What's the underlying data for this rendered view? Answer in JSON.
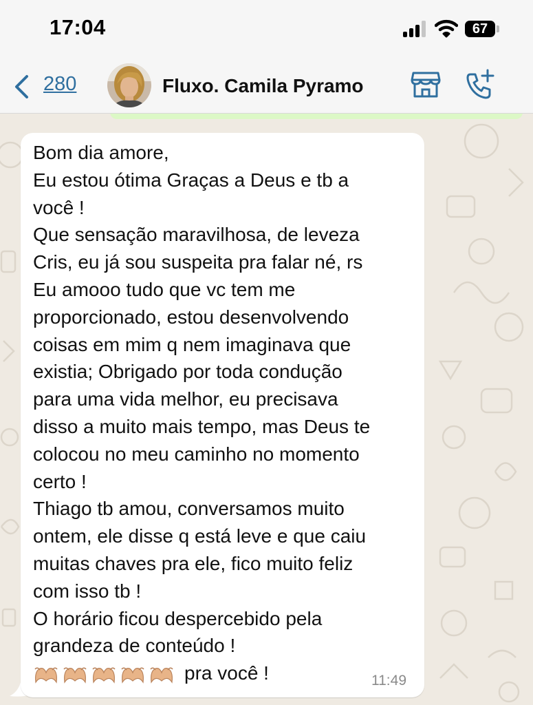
{
  "status_bar": {
    "time": "17:04",
    "battery": "67"
  },
  "header": {
    "back_count": "280",
    "contact_name": "Fluxo. Camila Pyramo",
    "icons": [
      "back-chevron-icon",
      "avatar",
      "store-icon",
      "add-call-icon"
    ]
  },
  "message": {
    "lines": [
      "Bom dia amore,",
      "Eu estou ótima Graças a Deus e tb a",
      "você !",
      "Que sensação maravilhosa, de leveza",
      "Cris, eu já sou suspeita pra falar né, rs",
      "Eu amooo tudo que vc tem me",
      "proporcionado, estou desenvolvendo",
      "coisas em mim q nem imaginava que",
      "existia; Obrigado por toda condução",
      "para uma vida melhor, eu precisava",
      "disso a muito mais tempo, mas Deus te",
      "colocou no meu caminho no momento",
      "certo !",
      "Thiago tb amou, conversamos muito",
      "ontem, ele disse q está leve e que caiu",
      "muitas chaves pra ele, fico muito feliz",
      "com isso tb !",
      "O horário ficou despercebido pela",
      "grandeza de conteúdo !"
    ],
    "last_line_emoji": "heart-hands-emoji x5",
    "last_line_text": "pra você !",
    "time": "11:49"
  },
  "colors": {
    "accent": "#2f6f9f",
    "header_bg": "#f6f6f6",
    "chat_bg": "#efeae2",
    "bubble_bg": "#ffffff",
    "outgoing_bubble": "#dcf8c6"
  }
}
